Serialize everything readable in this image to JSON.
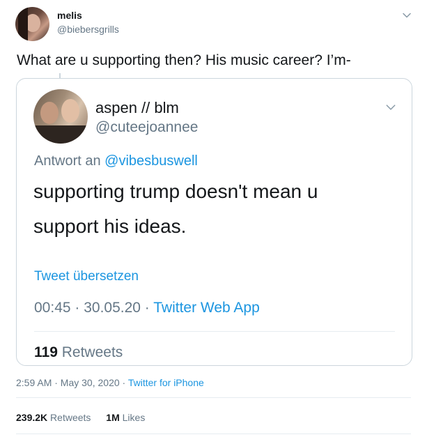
{
  "tweet": {
    "author_name": "melis",
    "author_handle": "@biebersgrills",
    "text": "What are u supporting then? His music career? I’m-",
    "timestamp": "2:59 AM · May 30, 2020 · ",
    "source": "Twitter for iPhone",
    "stats": {
      "retweets_count": "239.2K",
      "retweets_label": "Retweets",
      "likes_count": "1M",
      "likes_label": "Likes"
    }
  },
  "quoted": {
    "author_name": "aspen // blm",
    "author_handle": "@cuteejoannee",
    "reply_prefix": "Antwort an ",
    "reply_to": "@vibesbuswell",
    "text_line1": "supporting trump doesn't mean u",
    "text_line2": "support his ideas.",
    "translate_label": "Tweet übersetzen",
    "meta_time": "00:45 · 30.05.20 · ",
    "meta_source": "Twitter Web App",
    "retweets_count": "119",
    "retweets_label": "Retweets"
  },
  "icons": {
    "more": "chevron-down-icon"
  },
  "colors": {
    "link": "#1b95e0",
    "muted": "#657786",
    "border": "#ccd6dd",
    "text": "#14171a"
  }
}
